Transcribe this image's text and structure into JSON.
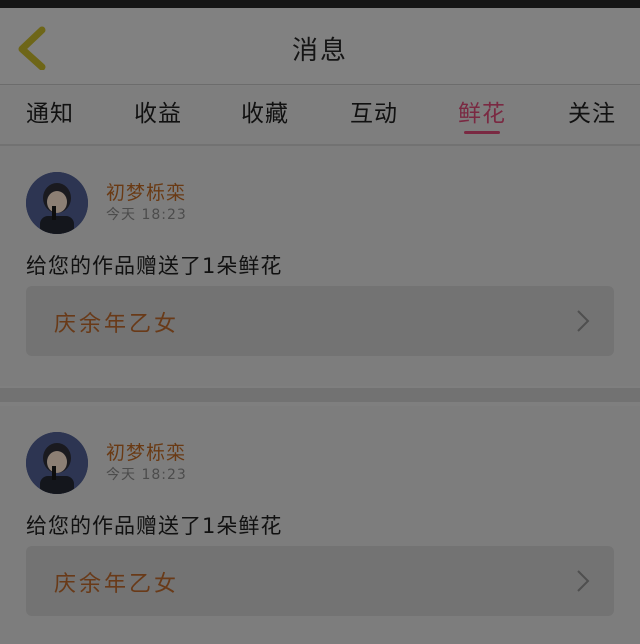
{
  "header": {
    "title": "消息",
    "back_icon": "back-chevron-icon"
  },
  "tabs": [
    {
      "label": "通知"
    },
    {
      "label": "收益"
    },
    {
      "label": "收藏"
    },
    {
      "label": "互动"
    },
    {
      "label": "鲜花",
      "active": true
    },
    {
      "label": "关注"
    }
  ],
  "messages": [
    {
      "username": "初梦栎栾",
      "time": "今天 18:23",
      "text": "给您的作品赠送了1朵鲜花",
      "work_title": "庆余年乙女"
    },
    {
      "username": "初梦栎栾",
      "time": "今天 18:23",
      "text": "给您的作品赠送了1朵鲜花",
      "work_title": "庆余年乙女"
    }
  ],
  "colors": {
    "accent": "#7a2942",
    "username": "#6a3a14",
    "work_title": "#693a18",
    "back_icon": "#6e6618"
  }
}
